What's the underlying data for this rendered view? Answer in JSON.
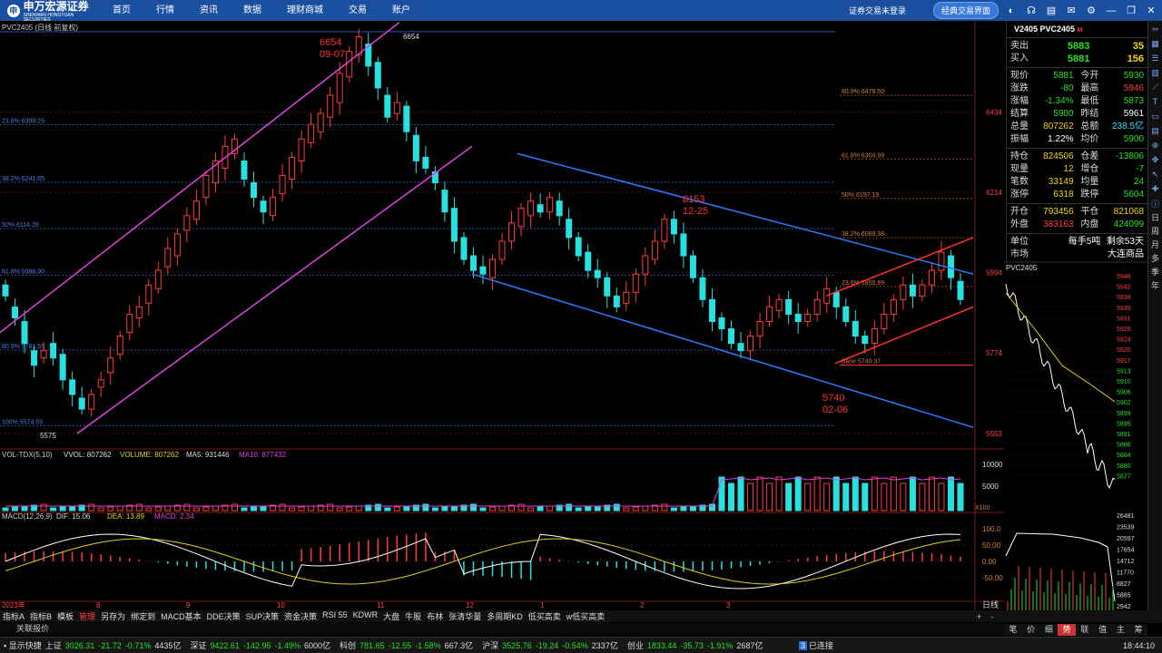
{
  "topbar": {
    "brand": "申万宏源证券",
    "brand_sub": "SHENWAN HONGYUAN SECURITIES",
    "nav": [
      "首页",
      "行情",
      "资讯",
      "数据",
      "理财商城",
      "交易",
      "账户"
    ],
    "notice": "证券交易未登录",
    "classic_button": "经典交易界面",
    "icons": [
      "skin-icon",
      "headset-icon",
      "message-icon",
      "mail-icon",
      "settings-icon",
      "minimize-icon",
      "restore-icon",
      "close-icon"
    ]
  },
  "chart": {
    "title": "PVC2405 (日线 前复权)",
    "price_axis": [
      "6434",
      "6214",
      "5994",
      "5774",
      "5553"
    ],
    "x_axis": [
      "2023年",
      "8",
      "9",
      "10",
      "11",
      "12",
      "1",
      "2",
      "3"
    ],
    "period_label": "日线",
    "annotations": {
      "high": {
        "value": "6654",
        "date": "09-07"
      },
      "mid": {
        "value": "6153",
        "date": "12-25"
      },
      "low": {
        "value": "5740",
        "date": "02-06"
      },
      "high_tag": "6654",
      "low_tag": "5575"
    },
    "fib_left": [
      "23.6% 6399.25",
      "38.2% 6241.65",
      "50% 6114.28",
      "61.8% 5986.90",
      "80.9% 5781.55",
      "100% 5574.55"
    ],
    "fib_right": [
      "80.9% 6479.50",
      "61.8% 6304.99",
      "50% 6197.19",
      "38.2% 6089.38",
      "23.6% 5955.99",
      "Base 5740.37"
    ]
  },
  "volume": {
    "label": "VOL-TDX(5,10)",
    "vvol": "VVOL: 807262",
    "volume": "VOLUME: 807262",
    "ma5": "MA5: 931446",
    "ma10": "MA10: 877432",
    "axis": [
      "10000",
      "5000",
      "X100"
    ]
  },
  "macd": {
    "label": "MACD(12,26,9)",
    "dif": "DIF: 15.06",
    "dea": "DEA: 13.89",
    "macd": "MACD: 2.34",
    "axis": [
      "100.0",
      "50.00",
      "0.00",
      "-50.00"
    ]
  },
  "quote": {
    "title": "V2405 PVC2405",
    "title_mark": "M",
    "sell": {
      "label": "卖出",
      "price": "5883",
      "vol": "35"
    },
    "buy": {
      "label": "买入",
      "price": "5881",
      "vol": "156"
    },
    "rows": [
      [
        "现价",
        "5881",
        "今开",
        "5930"
      ],
      [
        "涨跌",
        "-80",
        "最高",
        "5946"
      ],
      [
        "涨幅",
        "-1.34%",
        "最低",
        "5873"
      ],
      [
        "结算",
        "5900",
        "昨结",
        "5961"
      ],
      [
        "总量",
        "807262",
        "总额",
        "238.5亿"
      ],
      [
        "振幅",
        "1.22%",
        "均价",
        "5900"
      ]
    ],
    "rows2": [
      [
        "持仓",
        "824506",
        "仓差",
        "-13806"
      ],
      [
        "现量",
        "12",
        "增仓",
        "-7"
      ],
      [
        "笔数",
        "33149",
        "均量",
        "24"
      ],
      [
        "涨停",
        "6318",
        "跌停",
        "5604"
      ]
    ],
    "rows3": [
      [
        "开仓",
        "793456",
        "平仓",
        "821068"
      ],
      [
        "外盘",
        "383163",
        "内盘",
        "424099"
      ]
    ],
    "unit": {
      "label": "单位",
      "value": "每手5吨",
      "extra": "剩余53天"
    },
    "market": {
      "label": "市场",
      "value": "大连商品"
    }
  },
  "intraday": {
    "title": "PVC2405",
    "price_axis": [
      "5946",
      "5942",
      "5939",
      "5935",
      "5931",
      "5928",
      "5924",
      "5920",
      "5917",
      "5913",
      "5910",
      "5906",
      "5902",
      "5899",
      "5895",
      "5891",
      "5888",
      "5884",
      "5880",
      "5877"
    ],
    "vol_axis": [
      "26481",
      "23539",
      "20597",
      "17654",
      "14712",
      "11770",
      "8827",
      "5885",
      "2942"
    ]
  },
  "right_toolbar": [
    "日",
    "周",
    "月",
    "多",
    "季",
    "年"
  ],
  "tabs": [
    "指标A",
    "指标B",
    "模板",
    "管理",
    "另存为",
    "绑定到",
    "MACD基本",
    "DDE决策",
    "SUP决策",
    "资金决策",
    "RSI 55",
    "KDWR",
    "大盘",
    "牛股",
    "布林",
    "张清华量",
    "多周期KD",
    "低买高卖",
    "w低买高卖"
  ],
  "active_tab": "管理",
  "right_tabs": [
    "笔",
    "价",
    "细",
    "势",
    "联",
    "值",
    "主",
    "筹"
  ],
  "active_right_tab": "势",
  "row2_text": "关联报价",
  "status": {
    "show_label": "显示快捷",
    "items": [
      {
        "name": "上证",
        "value": "3026.31",
        "chg": "-21.72",
        "pct": "-0.71%",
        "amt": "4435亿"
      },
      {
        "name": "深证",
        "value": "9422.61",
        "chg": "-142.95",
        "pct": "-1.49%",
        "amt": "6000亿"
      },
      {
        "name": "科创",
        "value": "781.65",
        "chg": "-12.55",
        "pct": "-1.58%",
        "amt": "667.3亿"
      },
      {
        "name": "沪深",
        "value": "3525.76",
        "chg": "-19.24",
        "pct": "-0.54%",
        "amt": "2337亿"
      },
      {
        "name": "创业",
        "value": "1833.44",
        "chg": "-35.73",
        "pct": "-1.91%",
        "amt": "2687亿"
      }
    ],
    "connection": "已连接",
    "connection_num": "3",
    "clock": "18:44:10"
  },
  "colors": {
    "up": "#ff3b3b",
    "down": "#27e0e0",
    "nav_bg": "#1a4fa0",
    "channel_up": "#e040e0",
    "channel_down": "#2a7cff",
    "channel_right": "#ff3030"
  }
}
